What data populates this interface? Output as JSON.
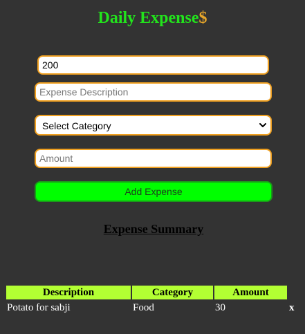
{
  "header": {
    "title_main": "Daily Expense",
    "title_suffix": "$"
  },
  "form": {
    "budget_value": "200",
    "description_placeholder": "Expense Description",
    "category_selected": "Select Category",
    "amount_placeholder": "Amount",
    "add_button_label": "Add Expense"
  },
  "summary": {
    "title": "Expense Summary",
    "columns": [
      "Description",
      "Category",
      "Amount"
    ],
    "rows": [
      {
        "description": "Potato for sabji",
        "category": "Food",
        "amount": "30",
        "delete_label": "x"
      }
    ]
  },
  "colors": {
    "background": "#333333",
    "title_green": "#22e51c",
    "dollar_orange": "#e7a62a",
    "input_border": "#f0a020",
    "button_green": "#00ff00",
    "table_header": "#b3ff33"
  }
}
